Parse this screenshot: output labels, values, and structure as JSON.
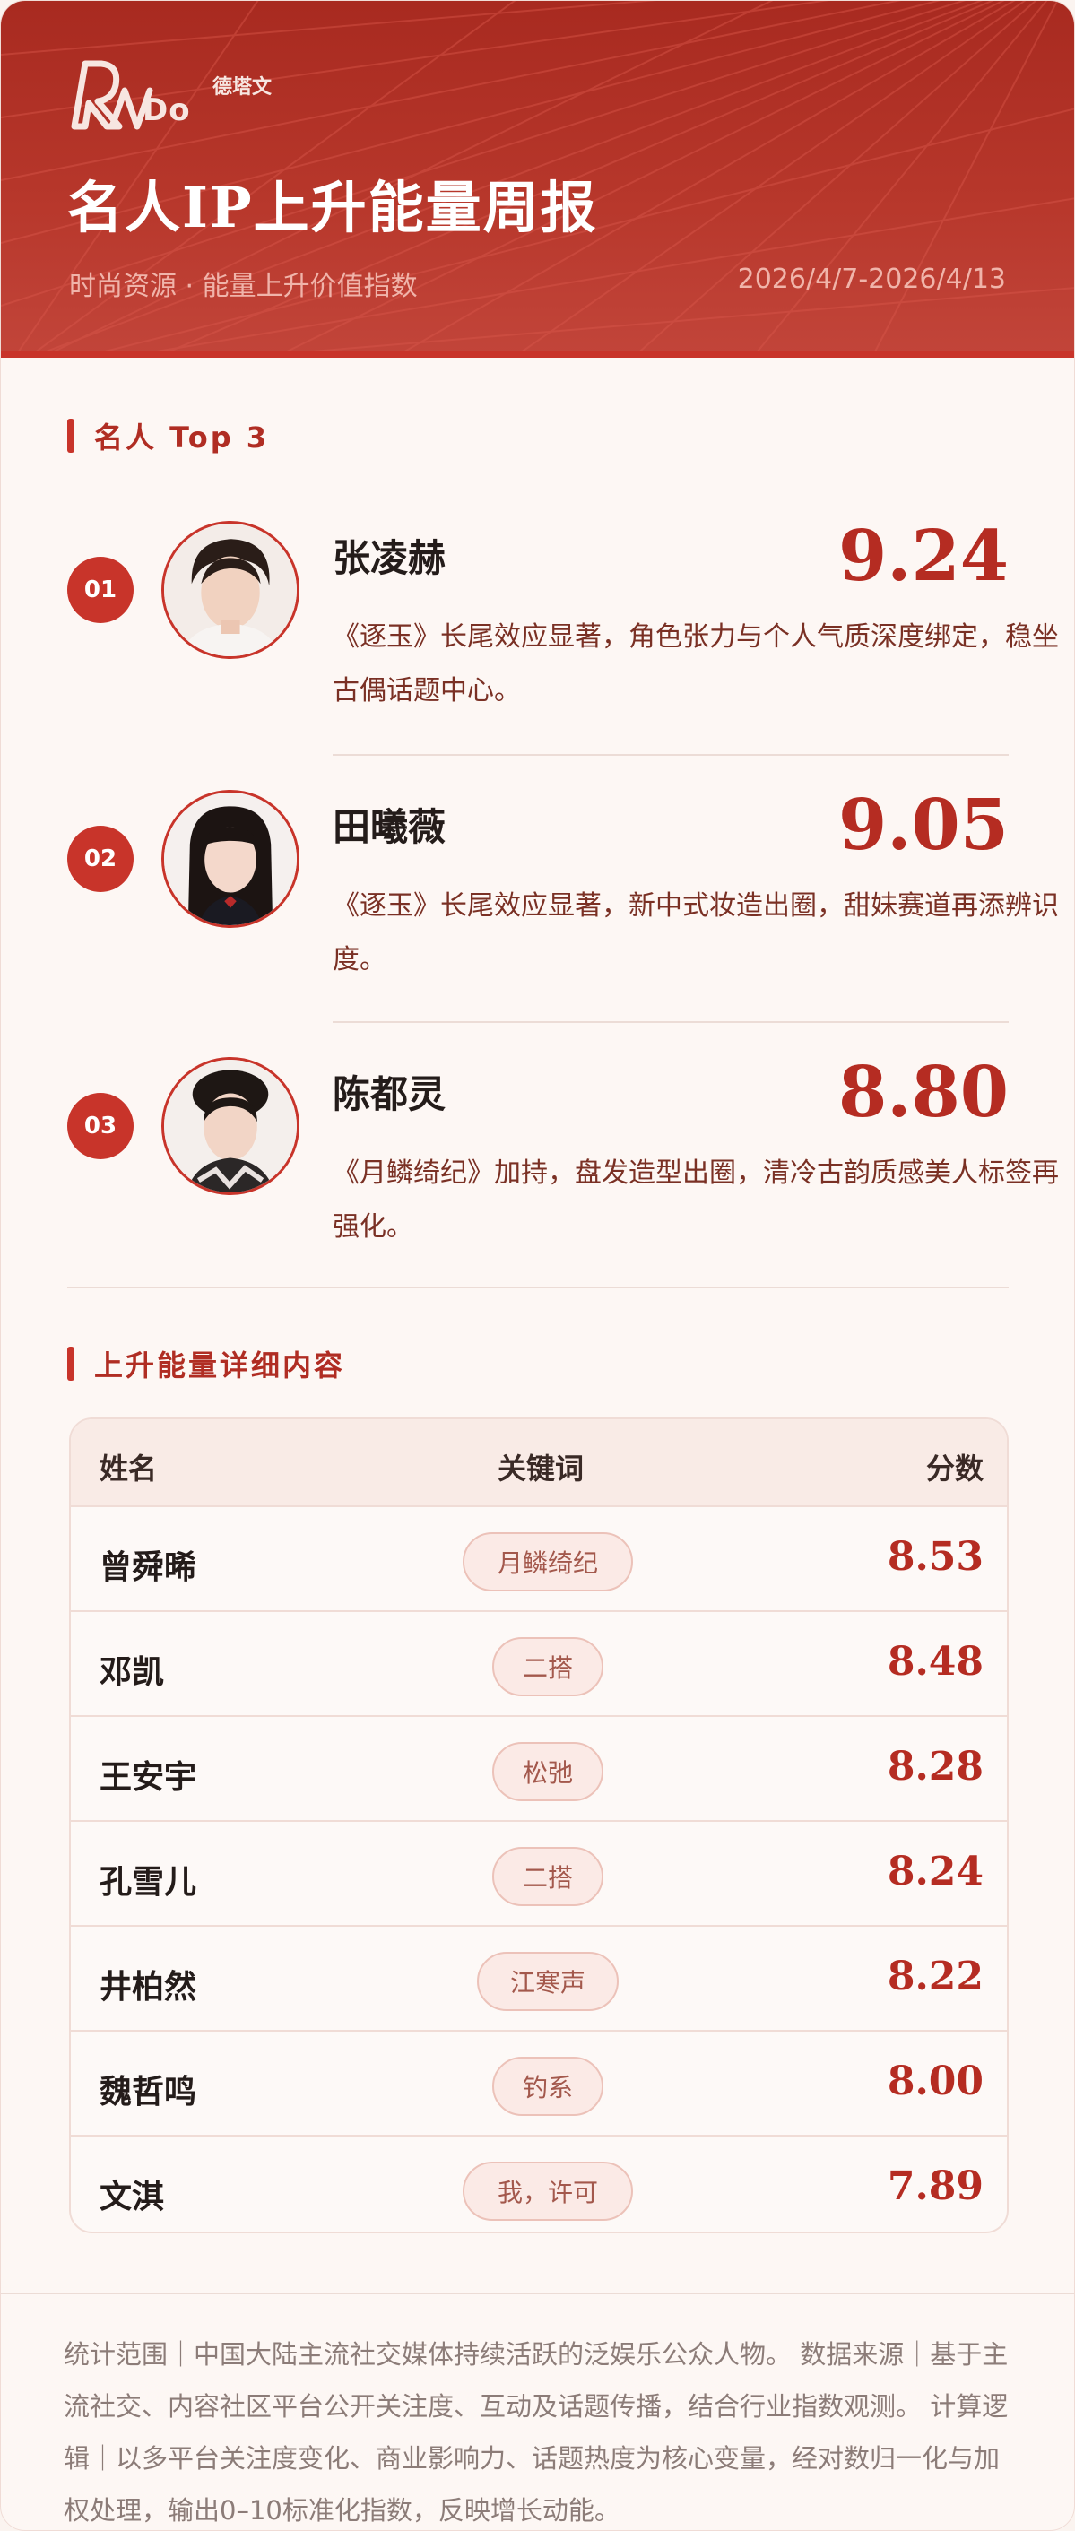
{
  "header": {
    "logo_text": "Do",
    "logo_sub": "德塔文",
    "title": "名人IP上升能量周报",
    "subtitle": "时尚资源 · 能量上升价值指数",
    "date_range": "2026/4/7-2026/4/13"
  },
  "top3": {
    "section_title": "名人 Top 3",
    "items": [
      {
        "rank": "01",
        "name": "张凌赫",
        "score": "9.24",
        "desc": "《逐玉》长尾效应显著，角色张力与个人气质深度绑定，稳坐古偶话题中心。"
      },
      {
        "rank": "02",
        "name": "田曦薇",
        "score": "9.05",
        "desc": "《逐玉》长尾效应显著，新中式妆造出圈，甜妹赛道再添辨识度。"
      },
      {
        "rank": "03",
        "name": "陈都灵",
        "score": "8.80",
        "desc": "《月鳞绮纪》加持，盘发造型出圈，清冷古韵质感美人标签再强化。"
      }
    ]
  },
  "details": {
    "section_title": "上升能量详细内容",
    "columns": {
      "name": "姓名",
      "keyword": "关键词",
      "score": "分数"
    },
    "rows": [
      {
        "name": "曾舜晞",
        "keyword": "月鳞绮纪",
        "score": "8.53"
      },
      {
        "name": "邓凯",
        "keyword": "二搭",
        "score": "8.48"
      },
      {
        "name": "王安宇",
        "keyword": "松弛",
        "score": "8.28"
      },
      {
        "name": "孔雪儿",
        "keyword": "二搭",
        "score": "8.24"
      },
      {
        "name": "井柏然",
        "keyword": "江寒声",
        "score": "8.22"
      },
      {
        "name": "魏哲鸣",
        "keyword": "钓系",
        "score": "8.00"
      },
      {
        "name": "文淇",
        "keyword": "我，许可",
        "score": "7.89"
      }
    ]
  },
  "footer": {
    "text": "统计范围｜中国大陆主流社交媒体持续活跃的泛娱乐公众人物。 数据来源｜基于主流社交、内容社区平台公开关注度、互动及话题传播，结合行业指数观测。 计算逻辑｜以多平台关注度变化、商业影响力、话题热度为核心变量，经对数归一化与加权处理，输出0–10标准化指数，反映增长动能。"
  },
  "colors": {
    "brand_red": "#c8342a",
    "score_red": "#b52c22",
    "header_bg": "#b7372b",
    "page_bg": "#fdf7f4"
  },
  "icons": [
    "brand-logo-icon",
    "avatar-portrait-icon"
  ]
}
